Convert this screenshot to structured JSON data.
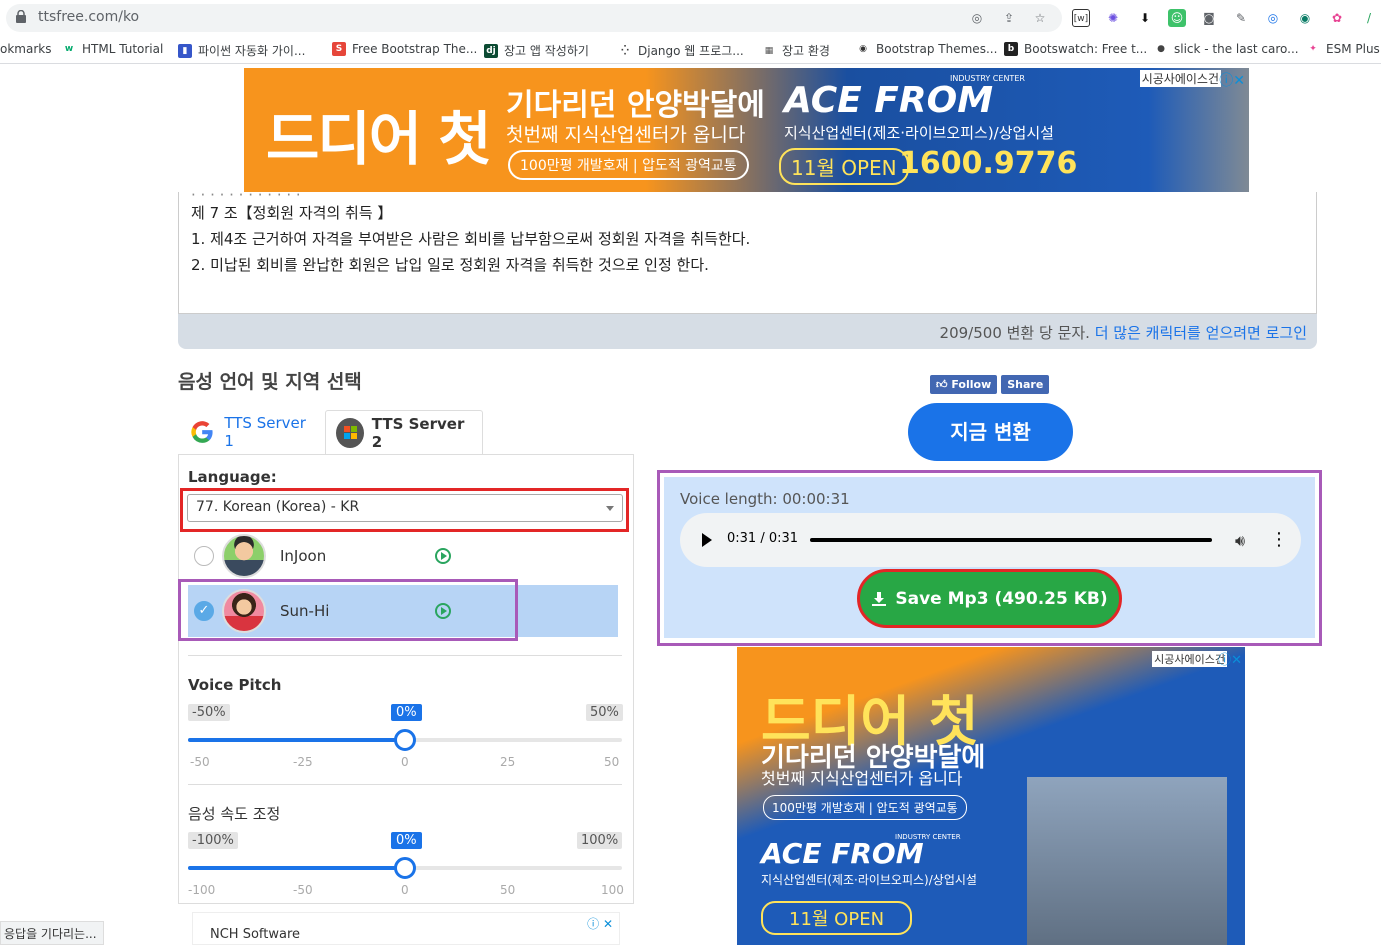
{
  "browser": {
    "url": "ttsfree.com/ko",
    "bookmarks": [
      {
        "label": "okmarks",
        "color": "#ffffff",
        "fav": ""
      },
      {
        "label": "HTML Tutorial",
        "color": "#04aa6d",
        "fav": "w"
      },
      {
        "label": "파이썬 자동화 가이...",
        "color": "#3656c9",
        "fav": "▮"
      },
      {
        "label": "Free Bootstrap The...",
        "color": "#e6463a",
        "fav": "S"
      },
      {
        "label": "장고 앱 작성하기",
        "color": "#0c4b33",
        "fav": "dj"
      },
      {
        "label": "Django 웹 프로그...",
        "color": "#444444",
        "fav": "⁛"
      },
      {
        "label": "장고 환경",
        "color": "#555555",
        "fav": "▦"
      },
      {
        "label": "Bootstrap Themes...",
        "color": "#333333",
        "fav": "◉"
      },
      {
        "label": "Bootswatch: Free t...",
        "color": "#222222",
        "fav": "b"
      },
      {
        "label": "slick - the last caro...",
        "color": "#444444",
        "fav": "●"
      },
      {
        "label": "ESM Plus",
        "color": "#e84393",
        "fav": "✦"
      }
    ]
  },
  "ads": {
    "top": {
      "headline": "드디어 첫",
      "line1": "기다리던 안양박달에",
      "line2": "첫번째 지식산업센터가 옵니다",
      "badge": "100만평 개발호재 | 압도적 광역교통",
      "industry": "INDUSTRY CENTER",
      "brand": "ACE FROM",
      "sub": "지식산업센터(제조·라이브오피스)/상업시설",
      "open": "11월 OPEN",
      "phone": "1600.9776",
      "corner": "시공사에이스건"
    },
    "right": {
      "headline": "드디어 첫",
      "line1": "기다리던 안양박달에",
      "line2": "첫번째 지식산업센터가 옵니다",
      "badge": "100만평 개발호재 | 압도적 광역교통",
      "industry": "INDUSTRY CENTER",
      "brand": "ACE FROM",
      "sub": "지식산업센터(제조·라이브오피스)/상업시설",
      "open": "11월 OPEN",
      "corner": "시공사에이스건"
    },
    "bottom_label": "NCH Software"
  },
  "text": {
    "cut_line": "· · · · · · · · · · · ·",
    "line1": "제 7 조【정회원 자격의 취득 】",
    "line2": "1. 제4조 근거하여 자격을 부여받은 사람은 회비를 납부함으로써 정회원 자격을 취득한다.",
    "line3": "2. 미납된 회비를 완납한 회원은 납입 일로 정회원 자격을 취득한 것으로 인정 한다.",
    "counter": "209/500 변환 당 문자.",
    "login_link": "더 많은 캐릭터를 얻으려면 로그인"
  },
  "section_title": "음성 언어 및 지역 선택",
  "tabs": [
    {
      "label": "TTS Server 1"
    },
    {
      "label": "TTS Server 2"
    }
  ],
  "language": {
    "label": "Language:",
    "value": "77. Korean (Korea) - KR"
  },
  "voices": [
    {
      "name": "InJoon",
      "selected": false
    },
    {
      "name": "Sun-Hi",
      "selected": true
    }
  ],
  "pitch": {
    "label": "Voice Pitch",
    "min": "-50%",
    "max": "50%",
    "value": "0%",
    "level": 0.5,
    "ticks": [
      "-50",
      "-25",
      "0",
      "25",
      "50"
    ]
  },
  "speed": {
    "label": "음성 속도 조정",
    "min": "-100%",
    "max": "100%",
    "value": "0%",
    "level": 0.5,
    "ticks": [
      "-100",
      "-50",
      "0",
      "50",
      "100"
    ]
  },
  "social": {
    "follow": "Follow",
    "share": "Share"
  },
  "convert_button": "지금 변환",
  "result": {
    "voice_length": "Voice length: 00:00:31",
    "time": "0:31 / 0:31",
    "save": "Save Mp3 (490.25 KB)"
  },
  "status": "응답을 기다리는..."
}
